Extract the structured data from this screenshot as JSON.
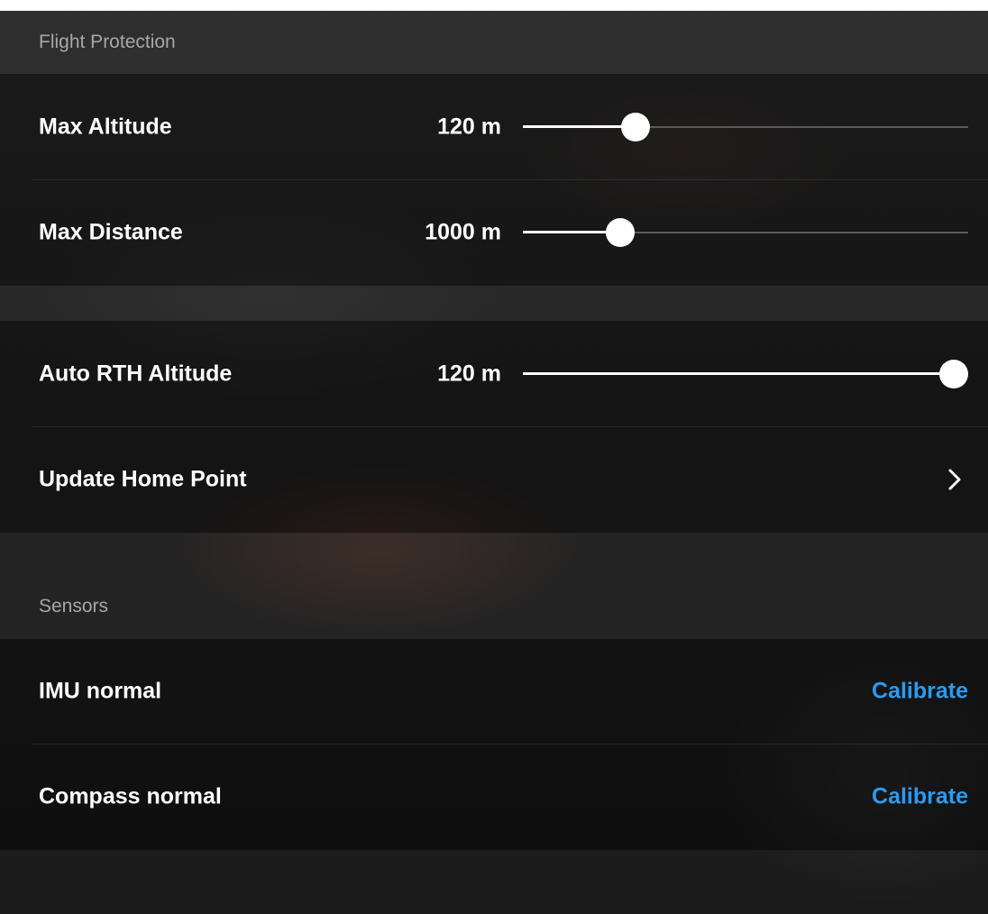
{
  "flight_protection": {
    "header": "Flight Protection",
    "max_altitude": {
      "label": "Max Altitude",
      "value_text": "120 m",
      "slider_fraction": 0.235
    },
    "max_distance": {
      "label": "Max Distance",
      "value_text": "1000 m",
      "slider_fraction": 0.2
    }
  },
  "rth": {
    "auto_rth_altitude": {
      "label": "Auto RTH Altitude",
      "value_text": "120 m",
      "slider_fraction": 1.0
    },
    "update_home_point": {
      "label": "Update Home Point",
      "icon": "chevron-right-icon"
    }
  },
  "sensors": {
    "header": "Sensors",
    "imu": {
      "label": "IMU normal",
      "action": "Calibrate"
    },
    "compass": {
      "label": "Compass normal",
      "action": "Calibrate"
    }
  },
  "colors": {
    "accent": "#2b9af3",
    "text": "#ffffff",
    "header_text": "#a7a7a7",
    "slider_track": "#5a5a5a"
  }
}
